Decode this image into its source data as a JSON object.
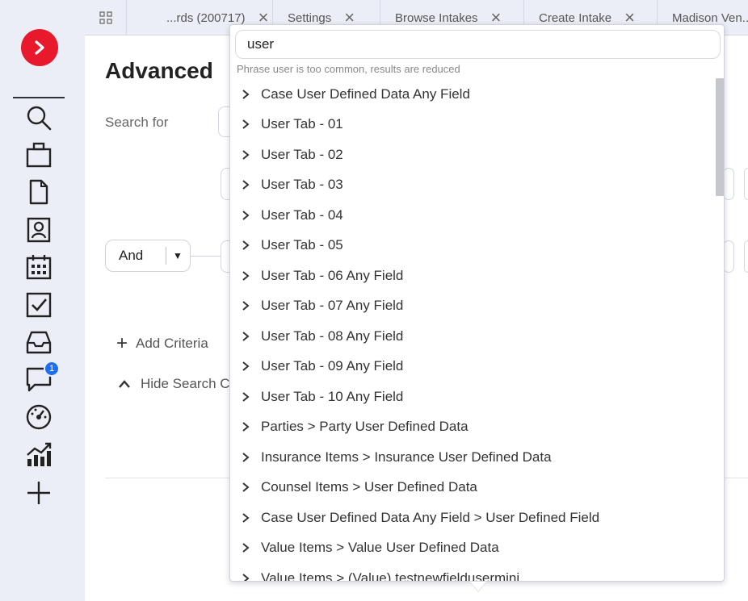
{
  "tabs": [
    {
      "label": "...rds (200717)"
    },
    {
      "label": "Settings"
    },
    {
      "label": "Browse Intakes"
    },
    {
      "label": "Create Intake"
    },
    {
      "label": "Madison Ven..."
    }
  ],
  "nav": {
    "messages_badge": "1"
  },
  "page": {
    "title": "Advanced",
    "search_for_label": "Search for",
    "operator_value": "And",
    "add_criteria": "Add Criteria",
    "hide_search": "Hide Search C"
  },
  "dropdown": {
    "query": "user",
    "hint": "Phrase user is too common, results are reduced",
    "items": [
      "Case User Defined Data Any Field",
      "User Tab - 01",
      "User Tab - 02",
      "User Tab - 03",
      "User Tab - 04",
      "User Tab - 05",
      "User Tab - 06 Any Field",
      "User Tab - 07 Any Field",
      "User Tab - 08 Any Field",
      "User Tab - 09 Any Field",
      "User Tab - 10 Any Field",
      "Parties > Party User Defined Data",
      "Insurance Items > Insurance User Defined Data",
      "Counsel Items > User Defined Data",
      "Case User Defined Data Any Field > User Defined Field",
      "Value Items > Value User Defined Data",
      "Value Items > (Value) testnewfieldusermini"
    ]
  },
  "colors": {
    "brand": "#e8192c",
    "badge": "#1e6ff0",
    "rail_bg": "#eceef7"
  }
}
